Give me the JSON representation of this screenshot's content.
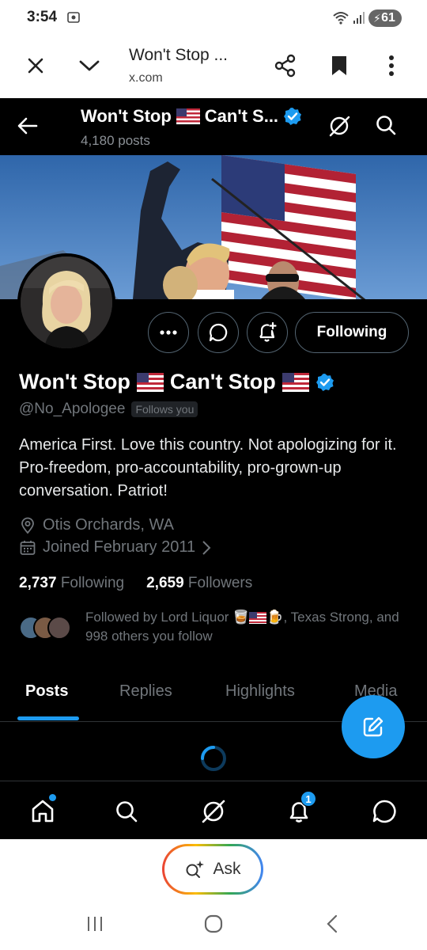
{
  "status_bar": {
    "time": "3:54",
    "battery": "61"
  },
  "browser": {
    "title": "Won't Stop ...",
    "url": "x.com"
  },
  "header": {
    "name": "Won't Stop",
    "name_rest": "Can't S...",
    "posts_count": "4,180 posts"
  },
  "profile": {
    "name_part1": "Won't Stop",
    "name_part2": "Can't Stop",
    "handle": "@No_Apologee",
    "follows_you": "Follows you",
    "bio": "America First. Love this country. Not apologizing for it. Pro-freedom, pro-accountability, pro-grown-up conversation. Patriot!",
    "location": "Otis Orchards, WA",
    "joined": "Joined February 2011",
    "following_count": "2,737",
    "following_label": "Following",
    "followers_count": "2,659",
    "followers_label": "Followers",
    "followed_by_prefix": "Followed by Lord Liquor",
    "followed_by_suffix": ", Texas Strong, and 998 others you follow",
    "follow_button": "Following"
  },
  "tabs": [
    {
      "label": "Posts",
      "active": true
    },
    {
      "label": "Replies",
      "active": false
    },
    {
      "label": "Highlights",
      "active": false
    },
    {
      "label": "Media",
      "active": false
    }
  ],
  "bottom_nav": {
    "notification_badge": "1",
    "items": [
      "home-icon",
      "search-icon",
      "grok-icon",
      "bell-icon",
      "messages-icon"
    ]
  },
  "assistant": {
    "ask_label": "Ask"
  },
  "colors": {
    "accent": "#1d9bf0",
    "background": "#000000",
    "muted": "#71767b"
  }
}
